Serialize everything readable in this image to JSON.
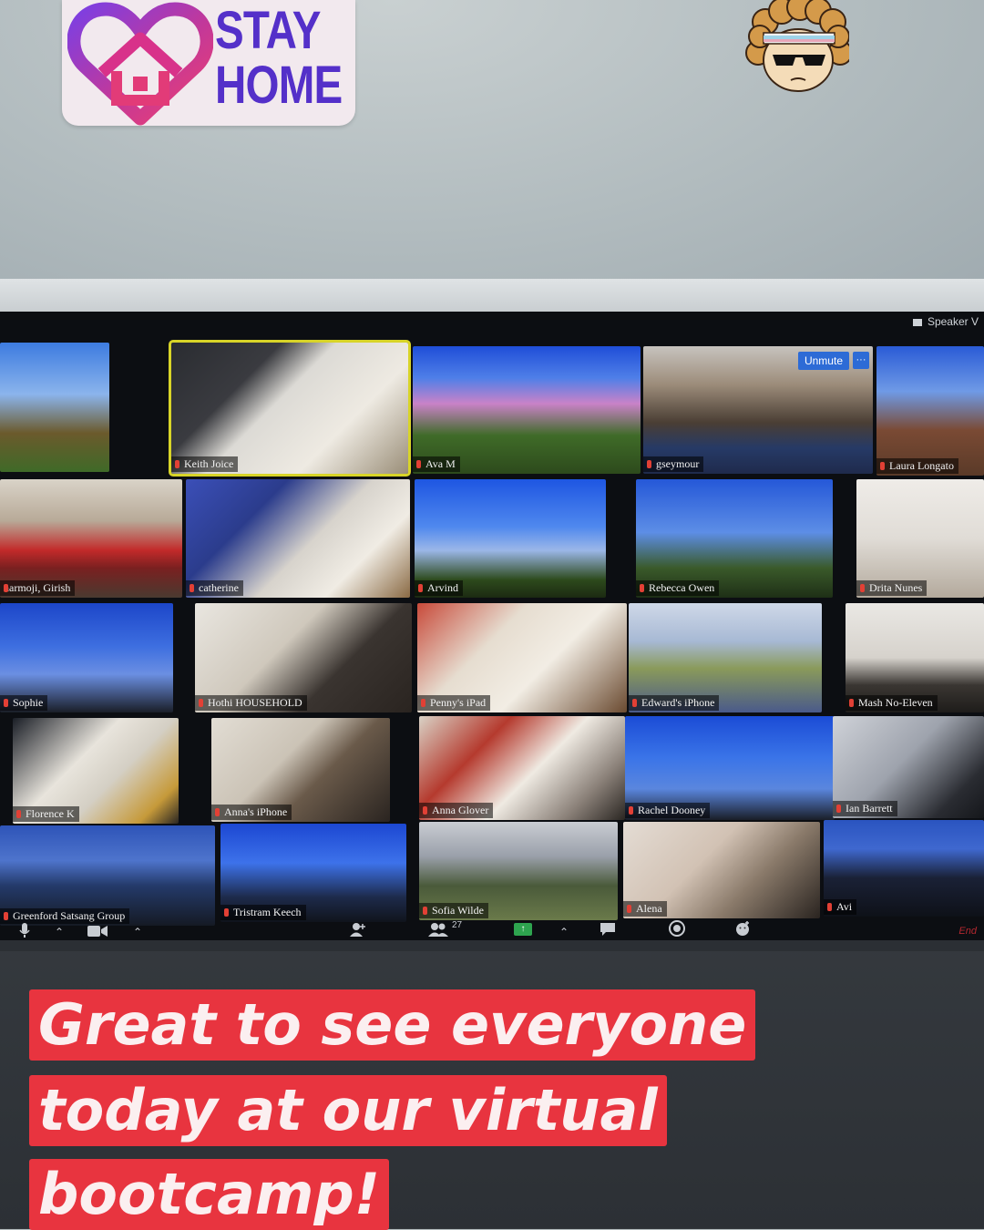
{
  "sticker": {
    "line1": "STAY",
    "line2": "HOME"
  },
  "header": {
    "speaker_view": "Speaker V"
  },
  "participants": [
    {
      "name": "",
      "muted": false
    },
    {
      "name": "Keith Joice",
      "muted": false
    },
    {
      "name": "Ava M",
      "muted": true
    },
    {
      "name": "gseymour",
      "muted": true
    },
    {
      "name": "Laura Longato",
      "muted": true
    },
    {
      "name": "narmoji, Girish",
      "muted": false
    },
    {
      "name": "catherine",
      "muted": true
    },
    {
      "name": "Arvind",
      "muted": true
    },
    {
      "name": "Rebecca Owen",
      "muted": true
    },
    {
      "name": "Drita Nunes",
      "muted": true
    },
    {
      "name": "Sophie",
      "muted": false
    },
    {
      "name": "Hothi HOUSEHOLD",
      "muted": true
    },
    {
      "name": "Penny's iPad",
      "muted": true
    },
    {
      "name": "Edward's iPhone",
      "muted": true
    },
    {
      "name": "Mash No-Eleven",
      "muted": true
    },
    {
      "name": "Florence K",
      "muted": true
    },
    {
      "name": "Anna's iPhone",
      "muted": true
    },
    {
      "name": "Anna Glover",
      "muted": true
    },
    {
      "name": "Rachel Dooney",
      "muted": true
    },
    {
      "name": "Ian Barrett",
      "muted": true
    },
    {
      "name": "Greenford Satsang Group",
      "muted": true
    },
    {
      "name": "Tristram Keech",
      "muted": true
    },
    {
      "name": "Sofia Wilde",
      "muted": true
    },
    {
      "name": "Alena",
      "muted": true
    },
    {
      "name": "Avi",
      "muted": true
    }
  ],
  "overlay": {
    "unmute": "Unmute",
    "more": "···"
  },
  "toolbar": {
    "participants_count": "27",
    "share_arrow": "↑",
    "end": "End"
  },
  "caption": {
    "line1": "Great to see everyone",
    "line2": "today at our virtual",
    "line3": "bootcamp!"
  },
  "colors": {
    "caption_bg": "#e8343f",
    "sticker_text": "#5430c9",
    "highlight": "#d8d428",
    "unmute": "#2d6bd6"
  }
}
